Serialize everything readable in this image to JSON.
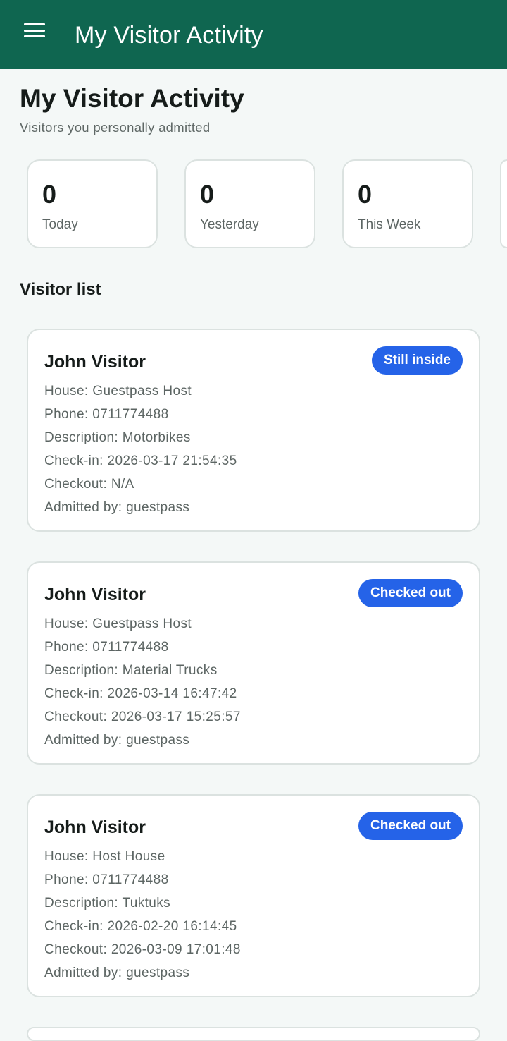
{
  "app_bar": {
    "title": "My Visitor Activity"
  },
  "header": {
    "title": "My Visitor Activity",
    "subtitle": "Visitors you personally admitted"
  },
  "stats": [
    {
      "value": "0",
      "label": "Today"
    },
    {
      "value": "0",
      "label": "Yesterday"
    },
    {
      "value": "0",
      "label": "This Week"
    }
  ],
  "visitor_list": {
    "title": "Visitor list",
    "items": [
      {
        "name": "John Visitor",
        "status": "Still inside",
        "house": "House: Guestpass Host",
        "phone": "Phone: 0711774488",
        "description": "Description: Motorbikes",
        "checkin": "Check-in: 2026-03-17 21:54:35",
        "checkout": "Checkout: N/A",
        "admitted_by": "Admitted by: guestpass"
      },
      {
        "name": "John Visitor",
        "status": "Checked out",
        "house": "House: Guestpass Host",
        "phone": "Phone: 0711774488",
        "description": "Description: Material Trucks",
        "checkin": "Check-in: 2026-03-14 16:47:42",
        "checkout": "Checkout: 2026-03-17 15:25:57",
        "admitted_by": "Admitted by: guestpass"
      },
      {
        "name": "John Visitor",
        "status": "Checked out",
        "house": "House: Host House",
        "phone": "Phone: 0711774488",
        "description": "Description: Tuktuks",
        "checkin": "Check-in: 2026-02-20 16:14:45",
        "checkout": "Checkout: 2026-03-09 17:01:48",
        "admitted_by": "Admitted by: guestpass"
      }
    ]
  },
  "colors": {
    "app_bar": "#0f6650",
    "badge": "#2563e8",
    "background": "#f4f8f7"
  },
  "icons": {
    "menu": "hamburger-menu-icon"
  }
}
